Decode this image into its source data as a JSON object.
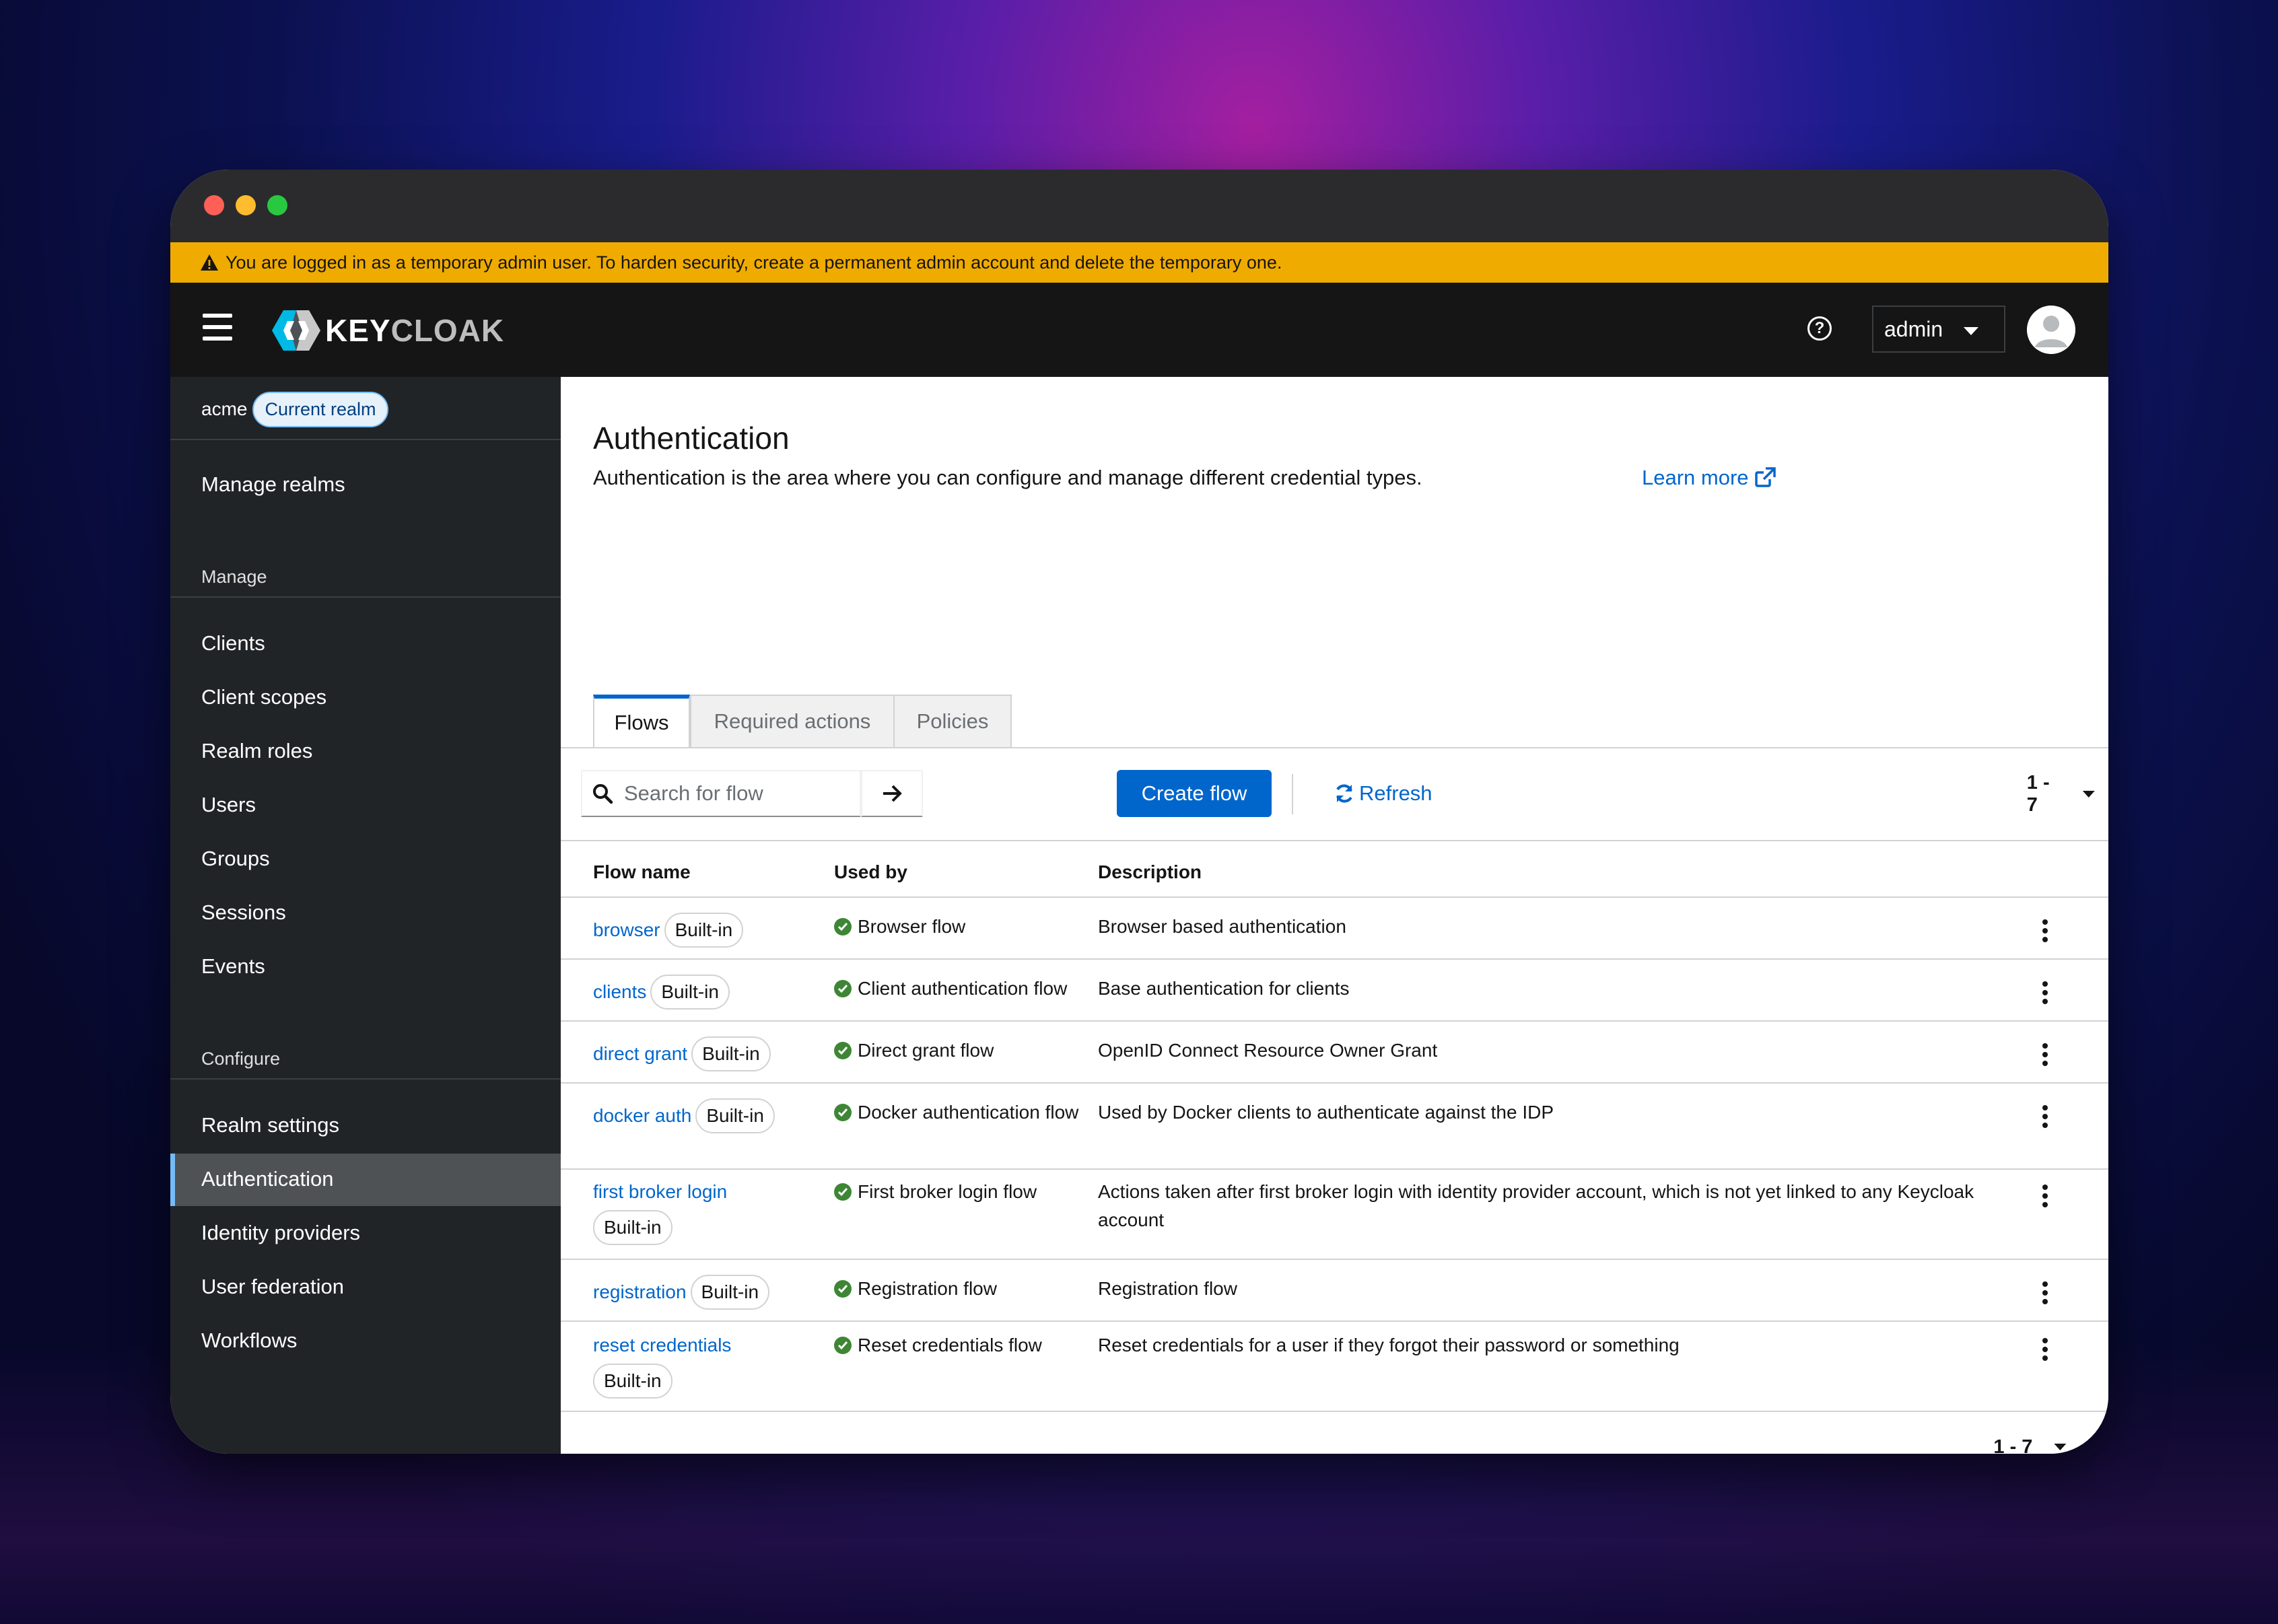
{
  "banner": {
    "text": "You are logged in as a temporary admin user. To harden security, create a permanent admin account and delete the temporary one."
  },
  "masthead": {
    "brand": "KEYCLOAK",
    "brand_strong": "KEY",
    "brand_rest": "CLOAK",
    "user": "admin"
  },
  "sidebar": {
    "realm": "acme",
    "realm_badge": "Current realm",
    "manage_realms": "Manage realms",
    "groups": [
      {
        "title": "Manage",
        "items": [
          "Clients",
          "Client scopes",
          "Realm roles",
          "Users",
          "Groups",
          "Sessions",
          "Events"
        ]
      },
      {
        "title": "Configure",
        "items": [
          "Realm settings",
          "Authentication",
          "Identity providers",
          "User federation",
          "Workflows"
        ]
      }
    ],
    "active_item": "Authentication"
  },
  "page": {
    "title": "Authentication",
    "description": "Authentication is the area where you can configure and manage different credential types.",
    "learn_more": "Learn more"
  },
  "tabs": [
    {
      "label": "Flows",
      "active": true
    },
    {
      "label": "Required actions",
      "active": false
    },
    {
      "label": "Policies",
      "active": false
    }
  ],
  "toolbar": {
    "search_placeholder": "Search for flow",
    "create_label": "Create flow",
    "refresh_label": "Refresh",
    "pagination": "1 - 7"
  },
  "table": {
    "columns": [
      "Flow name",
      "Used by",
      "Description"
    ],
    "rows": [
      {
        "name": "browser",
        "badge": "Built-in",
        "used_by": "Browser flow",
        "description": "Browser based authentication"
      },
      {
        "name": "clients",
        "badge": "Built-in",
        "used_by": "Client authentication flow",
        "description": "Base authentication for clients"
      },
      {
        "name": "direct grant",
        "badge": "Built-in",
        "used_by": "Direct grant flow",
        "description": "OpenID Connect Resource Owner Grant"
      },
      {
        "name": "docker auth",
        "badge": "Built-in",
        "used_by": "Docker authentication flow",
        "description": "Used by Docker clients to authenticate against the IDP"
      },
      {
        "name": "first broker login",
        "badge": "Built-in",
        "used_by": "First broker login flow",
        "description": "Actions taken after first broker login with identity provider account, which is not yet linked to any Keycloak account"
      },
      {
        "name": "registration",
        "badge": "Built-in",
        "used_by": "Registration flow",
        "description": "Registration flow"
      },
      {
        "name": "reset credentials",
        "badge": "Built-in",
        "used_by": "Reset credentials flow",
        "description": "Reset credentials for a user if they forgot their password or something"
      }
    ]
  },
  "footer": {
    "pagination": "1 - 7"
  },
  "colors": {
    "accent": "#0066cc",
    "warning": "#f0ab00",
    "success": "#3e8635",
    "nav_bg": "#212427",
    "masthead_bg": "#151515"
  }
}
